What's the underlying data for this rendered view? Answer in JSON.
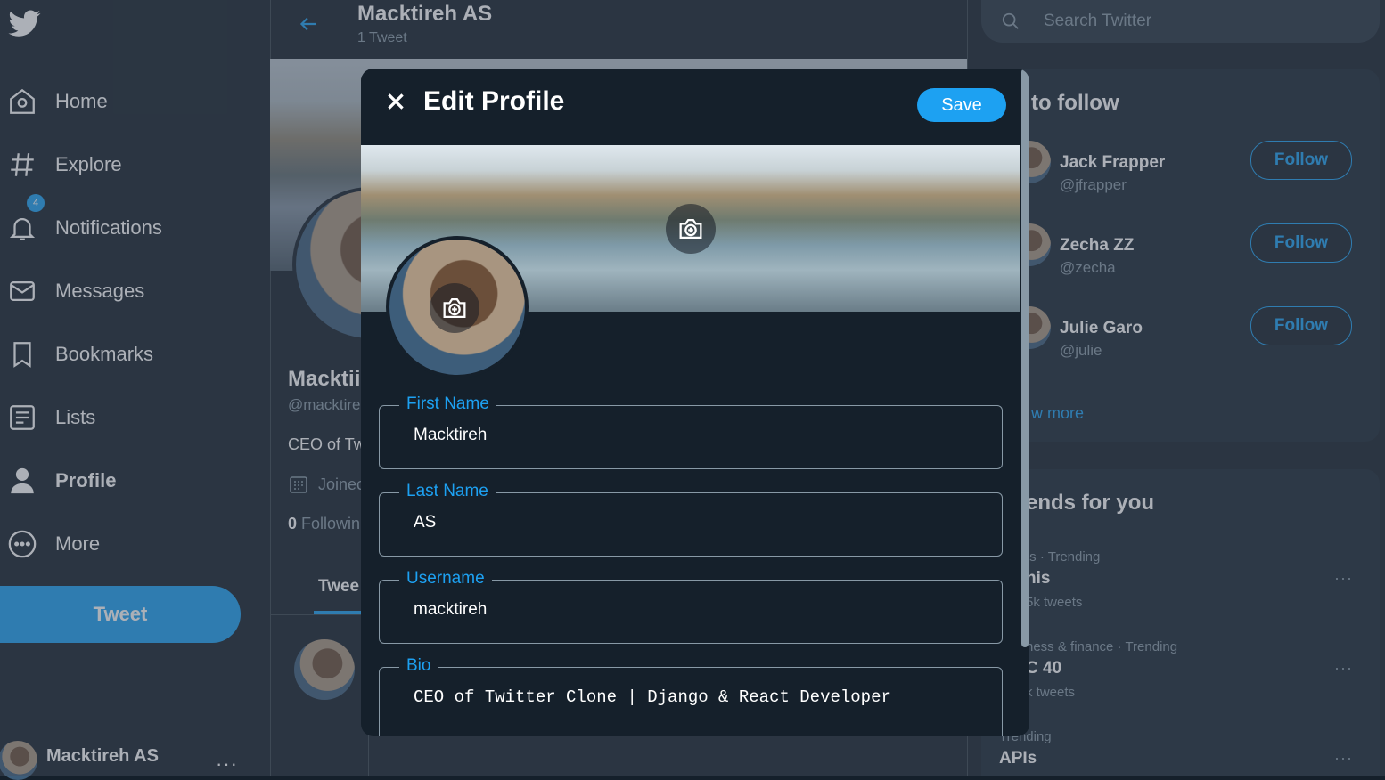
{
  "nav": {
    "items": [
      {
        "label": "Home",
        "icon": "home-icon"
      },
      {
        "label": "Explore",
        "icon": "hashtag-icon"
      },
      {
        "label": "Notifications",
        "icon": "bell-icon",
        "badge": "4"
      },
      {
        "label": "Messages",
        "icon": "envelope-icon"
      },
      {
        "label": "Bookmarks",
        "icon": "bookmark-icon"
      },
      {
        "label": "Lists",
        "icon": "list-icon"
      },
      {
        "label": "Profile",
        "icon": "person-icon",
        "active": true
      },
      {
        "label": "More",
        "icon": "more-circle-icon"
      }
    ],
    "tweet_button": "Tweet",
    "account_name": "Macktireh AS",
    "account_dots": "···"
  },
  "header": {
    "title": "Macktireh AS",
    "subtitle": "1 Tweet"
  },
  "profile": {
    "name": "Macktii",
    "handle": "@macktire",
    "bio": "CEO of Tw",
    "joined": "Joinec",
    "following_count": "0",
    "following_label": "Followin",
    "tab_tweets": "Twee"
  },
  "search": {
    "placeholder": "Search Twitter"
  },
  "who_to_follow": {
    "title": "ho to follow",
    "users": [
      {
        "name": "Jack Frapper",
        "handle": "@jfrapper",
        "button": "Follow"
      },
      {
        "name": "Zecha ZZ",
        "handle": "@zecha",
        "button": "Follow"
      },
      {
        "name": "Julie Garo",
        "handle": "@julie",
        "button": "Follow"
      }
    ],
    "show_more": "w more"
  },
  "trends": {
    "title": "ends for you",
    "items": [
      {
        "meta": "ts · Trending",
        "name": "nis",
        "count": "5k tweets"
      },
      {
        "meta": "ness & finance · Trending",
        "name": "C 40",
        "count": "k tweets"
      },
      {
        "meta": "Trending",
        "name": "APIs",
        "count": ""
      }
    ],
    "dots": "···"
  },
  "modal": {
    "title": "Edit Profile",
    "save": "Save",
    "fields": {
      "first_name": {
        "label": "First Name",
        "value": "Macktireh"
      },
      "last_name": {
        "label": "Last Name",
        "value": "AS"
      },
      "username": {
        "label": "Username",
        "value": "macktireh"
      },
      "bio": {
        "label": "Bio",
        "value": "CEO of Twitter Clone | Django & React Developer"
      }
    }
  },
  "colors": {
    "background": "#15202b",
    "accent": "#1da1f2",
    "secondary_text": "#8899a6"
  }
}
